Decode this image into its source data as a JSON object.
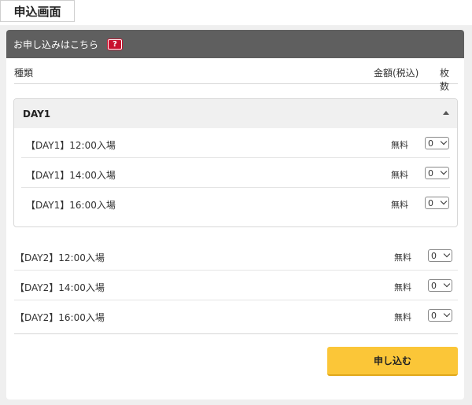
{
  "page_tab": "申込画面",
  "panel": {
    "title": "お申し込みはこちら",
    "help_badge": "?"
  },
  "columns": {
    "type": "種類",
    "price": "金額(税込)",
    "count": "枚数"
  },
  "day1": {
    "title": "DAY1",
    "expanded": true,
    "rows": [
      {
        "label": "【DAY1】12:00入場",
        "price": "無料",
        "qty": "0"
      },
      {
        "label": "【DAY1】14:00入場",
        "price": "無料",
        "qty": "0"
      },
      {
        "label": "【DAY1】16:00入場",
        "price": "無料",
        "qty": "0"
      }
    ]
  },
  "day2": {
    "rows": [
      {
        "label": "【DAY2】12:00入場",
        "price": "無料",
        "qty": "0"
      },
      {
        "label": "【DAY2】14:00入場",
        "price": "無料",
        "qty": "0"
      },
      {
        "label": "【DAY2】16:00入場",
        "price": "無料",
        "qty": "0"
      }
    ]
  },
  "submit_label": "申し込む",
  "colors": {
    "header_bg": "#5f5f5f",
    "help_badge": "#c8102e",
    "submit_bg": "#fbc638"
  }
}
